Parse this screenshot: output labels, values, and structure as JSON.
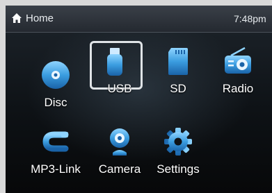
{
  "status": {
    "home_label": "Home",
    "time": "7:48pm"
  },
  "menu": {
    "items": [
      {
        "label": "Disc",
        "icon": "disc-icon"
      },
      {
        "label": "USB",
        "icon": "usb-icon",
        "selected": true
      },
      {
        "label": "SD",
        "icon": "sd-card-icon"
      },
      {
        "label": "Radio",
        "icon": "radio-icon"
      },
      {
        "label": "MP3-Link",
        "icon": "mp3-link-icon"
      },
      {
        "label": "Camera",
        "icon": "camera-icon"
      },
      {
        "label": "Settings",
        "icon": "gear-icon"
      }
    ]
  },
  "colors": {
    "icon_accent": "#3b9de0",
    "text": "#ffffff"
  }
}
